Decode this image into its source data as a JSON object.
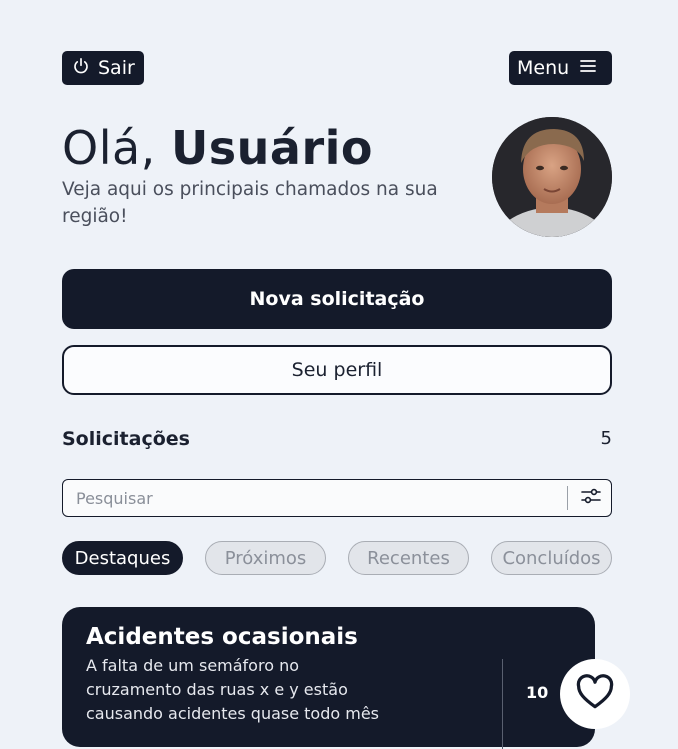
{
  "header": {
    "logout_label": "Sair",
    "menu_label": "Menu"
  },
  "hero": {
    "greeting": "Olá,",
    "user_name": "Usuário",
    "subtitle": "Veja aqui os principais chamados na sua região!"
  },
  "actions": {
    "new_request_label": "Nova solicitação",
    "profile_label": "Seu perfil"
  },
  "requests": {
    "title": "Solicitações",
    "count": "5",
    "search_placeholder": "Pesquisar",
    "filters": [
      "Destaques",
      "Próximos",
      "Recentes",
      "Concluídos"
    ],
    "active_filter": "Destaques"
  },
  "cards": [
    {
      "title": "Acidentes ocasionais",
      "description": "A falta de um semáforo no cruzamento das ruas x e y estão causando acidentes quase todo mês",
      "likes": "10"
    }
  ],
  "colors": {
    "background": "#eef2f8",
    "primary_dark": "#141a2a",
    "chip_idle": "#e2e5ea"
  },
  "icons": {
    "logout": "power-icon",
    "menu": "hamburger-icon",
    "filter": "sliders-icon",
    "like": "heart-icon"
  }
}
